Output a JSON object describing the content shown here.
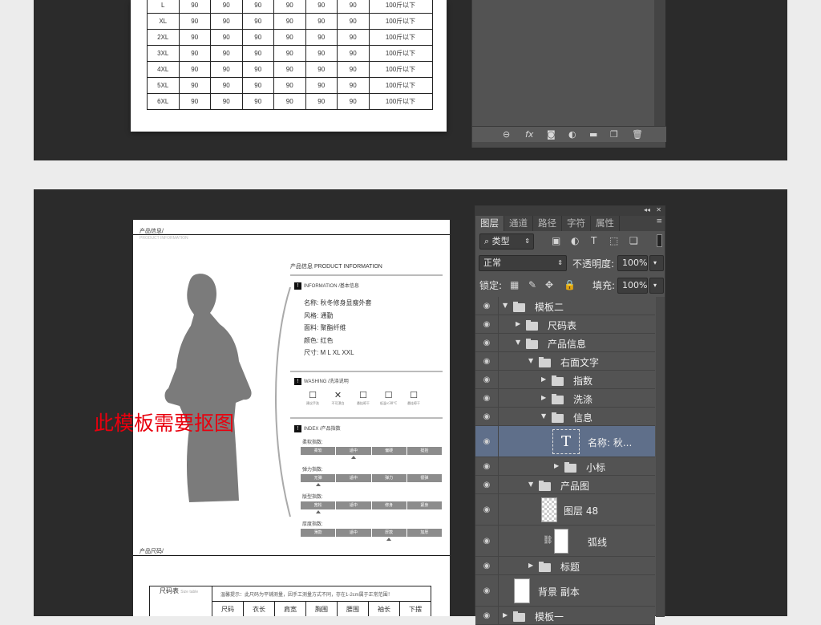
{
  "top_table": {
    "rows": [
      [
        "L",
        "90",
        "90",
        "90",
        "90",
        "90",
        "90",
        "100斤以下"
      ],
      [
        "XL",
        "90",
        "90",
        "90",
        "90",
        "90",
        "90",
        "100斤以下"
      ],
      [
        "2XL",
        "90",
        "90",
        "90",
        "90",
        "90",
        "90",
        "100斤以下"
      ],
      [
        "3XL",
        "90",
        "90",
        "90",
        "90",
        "90",
        "90",
        "100斤以下"
      ],
      [
        "4XL",
        "90",
        "90",
        "90",
        "90",
        "90",
        "90",
        "100斤以下"
      ],
      [
        "5XL",
        "90",
        "90",
        "90",
        "90",
        "90",
        "90",
        "100斤以下"
      ],
      [
        "6XL",
        "90",
        "90",
        "90",
        "90",
        "90",
        "90",
        "100斤以下"
      ]
    ]
  },
  "doc": {
    "header_label": "产品信息/",
    "header_sub": "PRODUCT INFORMATION",
    "info_title": "产品信息 PRODUCT INFORMATION",
    "basic_title": "INFORMATION /基本信息",
    "basic_lines": [
      "名称:  秋冬修身显瘦外套",
      "风格:  通勤",
      "面料:  聚酯纤维",
      "颜色:  红色",
      "尺寸:  M L XL XXL"
    ],
    "washing_title": "WASHING /洗涤说明",
    "washing_items": [
      {
        "sym": "☐",
        "label": "建议手洗"
      },
      {
        "sym": "✕",
        "label": "不可漂白"
      },
      {
        "sym": "☐",
        "label": "悬挂晾干"
      },
      {
        "sym": "☐",
        "label": "低温<30°C"
      },
      {
        "sym": "☐",
        "label": "悬挂晾干"
      }
    ],
    "index_title": "INDEX /产品指数",
    "indices": [
      {
        "label": "柔软指数:",
        "cells": [
          "柔软",
          "适中",
          "偏硬",
          "挺括"
        ]
      },
      {
        "label": "弹力指数:",
        "cells": [
          "无弹",
          "适中",
          "弹力",
          "很弹"
        ]
      },
      {
        "label": "版型指数:",
        "cells": [
          "宽松",
          "适中",
          "修身",
          "紧身"
        ]
      },
      {
        "label": "厚度指数:",
        "cells": [
          "薄款",
          "适中",
          "厚款",
          "加厚"
        ]
      }
    ],
    "size_label": "产品尺码/",
    "size_table_title": "尺码表",
    "size_table_sub": "Size table",
    "size_note": "温馨提示：此尺码为平铺测量，因手工测量方式不同，存在1-2cm属于正常范围！",
    "size_headers": [
      "尺码",
      "衣长",
      "肩宽",
      "胸围",
      "腰围",
      "袖长",
      "下摆"
    ]
  },
  "warning_text": "此模板需要抠图",
  "layers_panel": {
    "tabs": [
      "图层",
      "通道",
      "路径",
      "字符",
      "属性"
    ],
    "filter_label": "类型",
    "blend_mode": "正常",
    "opacity_label": "不透明度:",
    "opacity_value": "100%",
    "lock_label": "锁定:",
    "fill_label": "填充:",
    "fill_value": "100%",
    "layers": [
      {
        "name": "模板二",
        "type": "group",
        "expanded": true
      },
      {
        "name": "尺码表",
        "type": "group",
        "expanded": false
      },
      {
        "name": "产品信息",
        "type": "group",
        "expanded": true
      },
      {
        "name": "右面文字",
        "type": "group",
        "expanded": true
      },
      {
        "name": "指数",
        "type": "group",
        "expanded": false
      },
      {
        "name": "洗涤",
        "type": "group",
        "expanded": false
      },
      {
        "name": "信息",
        "type": "group",
        "expanded": true
      },
      {
        "name": "名称:  秋...",
        "type": "text",
        "selected": true
      },
      {
        "name": "小标",
        "type": "group",
        "expanded": false
      },
      {
        "name": "产品图",
        "type": "group",
        "expanded": true
      },
      {
        "name": "图层 48",
        "type": "pixel"
      },
      {
        "name": "弧线",
        "type": "masked"
      },
      {
        "name": "标题",
        "type": "group",
        "expanded": false
      },
      {
        "name": "背景 副本",
        "type": "pixel"
      },
      {
        "name": "模板一",
        "type": "group",
        "expanded": false
      }
    ]
  },
  "colors": {
    "accent_selected": "#5f6f8a",
    "warning": "#e8000e",
    "panel_bg": "#535353"
  }
}
